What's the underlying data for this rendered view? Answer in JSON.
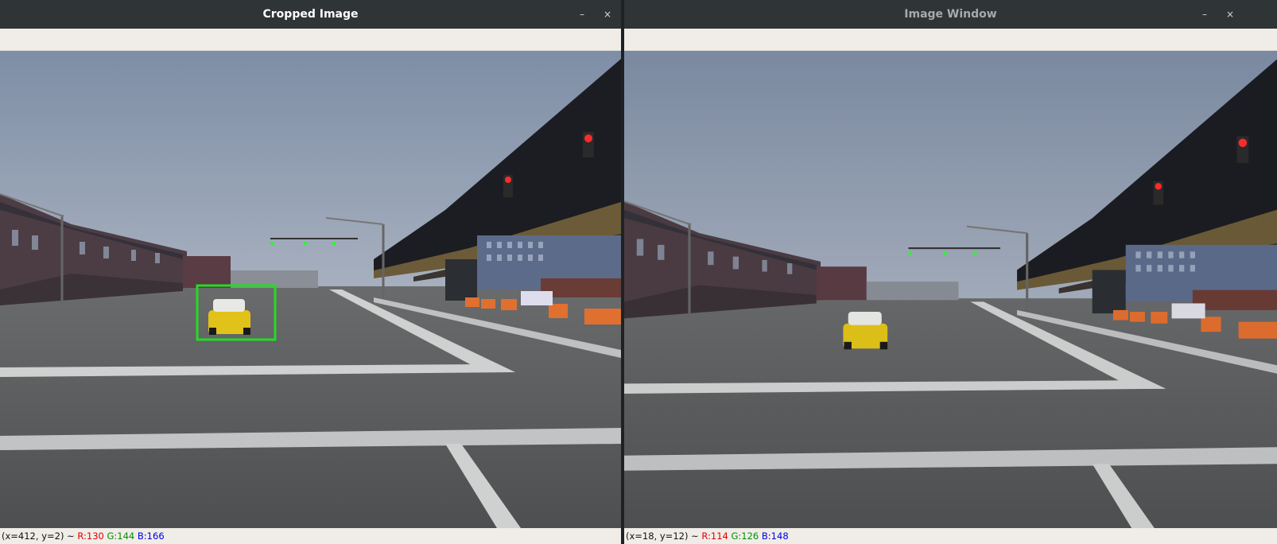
{
  "left_window": {
    "title": "Cropped Image",
    "minimize": "–",
    "close": "×",
    "status": {
      "coords": "(x=412, y=2) ~ ",
      "r": "R:130",
      "g": "G:144",
      "b": "B:166"
    }
  },
  "right_window": {
    "title": "Image Window",
    "minimize": "–",
    "close": "×",
    "status": {
      "coords": "(x=18, y=12) ~ ",
      "r": "R:114",
      "g": "G:126",
      "b": "B:148"
    }
  },
  "detection_box_color": "#22dd22",
  "icons": {
    "minimize": "minimize-icon",
    "close": "close-icon"
  }
}
